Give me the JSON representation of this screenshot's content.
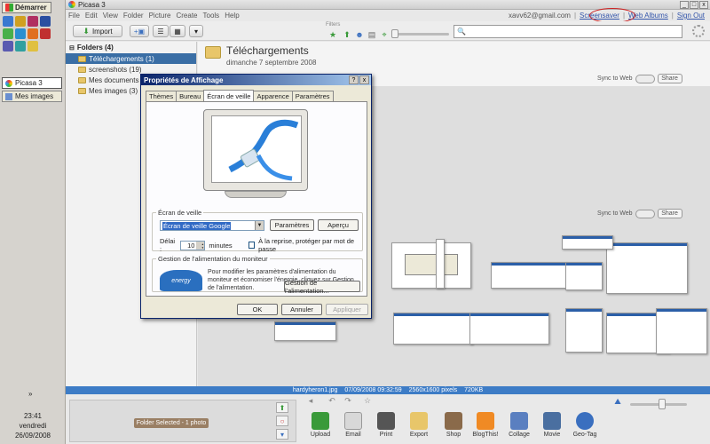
{
  "taskbar": {
    "start_label": "Démarrer",
    "tasks": [
      {
        "label": "Picasa 3"
      },
      {
        "label": "Mes images"
      }
    ],
    "clock": {
      "time": "23:41",
      "day": "vendredi",
      "date": "26/09/2008"
    },
    "tray_chevron": "»"
  },
  "window": {
    "title": "Picasa 3",
    "min": "_",
    "max": "□",
    "close": "x"
  },
  "menu": [
    "File",
    "Edit",
    "View",
    "Folder",
    "Picture",
    "Create",
    "Tools",
    "Help"
  ],
  "user_links": {
    "email": "xavv62@gmail.com",
    "screensaver": "Screensaver",
    "web_albums": "Web Albums",
    "sign_out": "Sign Out",
    "sep": "|"
  },
  "toolbar": {
    "import_label": "Import",
    "filters_label": "Filters"
  },
  "folders": {
    "header": "Folders (4)",
    "items": [
      {
        "label": "Téléchargements (1)",
        "selected": true
      },
      {
        "label": "screenshots (19)"
      },
      {
        "label": "Mes documents"
      },
      {
        "label": "Mes images (3)"
      }
    ]
  },
  "library": {
    "title": "Téléchargements",
    "date": "dimanche 7 septembre 2008",
    "sync_label": "Sync to Web",
    "share_label": "Share"
  },
  "status_bar": {
    "filename": "hardyheron1.jpg",
    "datetime": "07/09/2008 09:32:59",
    "dimensions": "2560x1600 pixels",
    "size": "720KB"
  },
  "tray": {
    "selected_label": "Folder Selected - 1 photo",
    "actions": [
      {
        "label": "Upload",
        "color": "#3a9a3a"
      },
      {
        "label": "Email",
        "color": "#d8d8d8"
      },
      {
        "label": "Print",
        "color": "#555555"
      },
      {
        "label": "Export",
        "color": "#e8c66a"
      },
      {
        "label": "Shop",
        "color": "#8a6a4a"
      },
      {
        "label": "BlogThis!",
        "color": "#f08a24"
      },
      {
        "label": "Collage",
        "color": "#5a7fc0"
      },
      {
        "label": "Movie",
        "color": "#4a6fa0"
      },
      {
        "label": "Geo-Tag",
        "color": "#3a6fbf"
      }
    ]
  },
  "dialog": {
    "title": "Propriétés de Affichage",
    "help": "?",
    "close": "x",
    "tabs": [
      "Thèmes",
      "Bureau",
      "Écran de veille",
      "Apparence",
      "Paramètres"
    ],
    "active_tab": "Écran de veille",
    "screensaver_group": "Écran de veille",
    "screensaver_value": "Écran de veille Google",
    "settings_btn": "Paramètres",
    "preview_btn": "Aperçu",
    "delay_label": "Délai :",
    "delay_value": "10",
    "minutes_label": "minutes",
    "resume_label": "À la reprise, protéger par mot de passe",
    "power_group": "Gestion de l'alimentation du moniteur",
    "power_text": "Pour modifier les paramètres d'alimentation du moniteur et économiser l'énergie, cliquez sur Gestion de l'alimentation.",
    "power_btn": "Gestion de l'alimentation...",
    "energy_logo": "energy",
    "ok": "OK",
    "cancel": "Annuler",
    "apply": "Appliquer"
  }
}
